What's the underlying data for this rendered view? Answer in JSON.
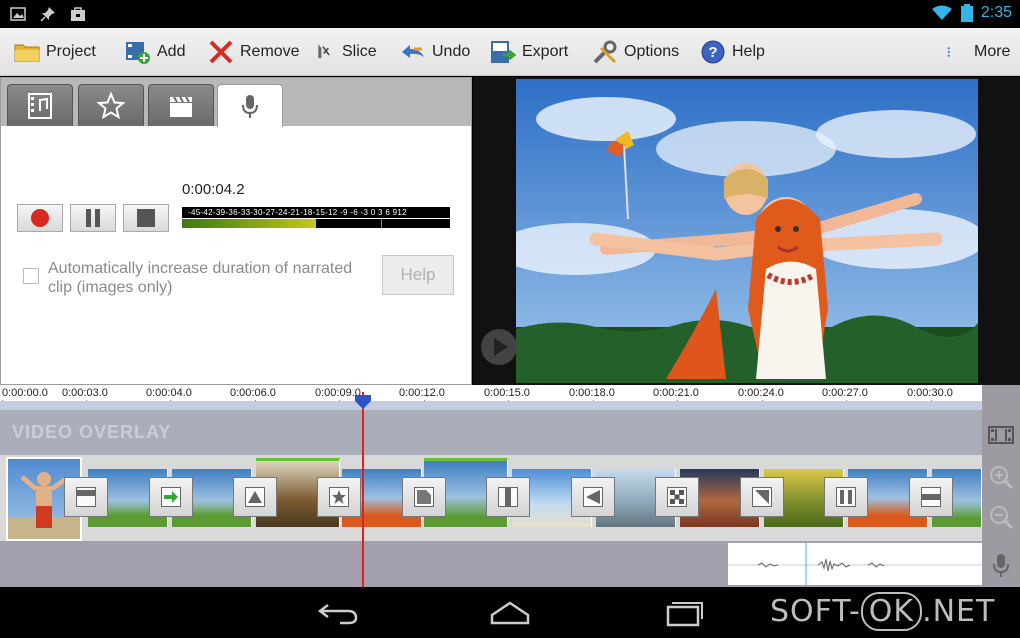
{
  "status_bar": {
    "time": "2:35"
  },
  "toolbar": {
    "project": "Project",
    "add": "Add",
    "remove": "Remove",
    "slice": "Slice",
    "undo": "Undo",
    "export": "Export",
    "options": "Options",
    "help": "Help",
    "more": "More"
  },
  "narration": {
    "elapsed": "0:00:04.2",
    "meter_scale": "-45-42-39-36-33-30-27-24-21-18-15-12 -9  -6  -3   0   3   6  912",
    "meter_level_fraction": 0.5,
    "auto_duration_label": "Automatically increase duration of narrated clip (images only)",
    "help_button": "Help"
  },
  "timeline": {
    "ruler_labels": [
      "0:00:00.0",
      "0:00:03.0",
      "0:00:04.0",
      "0:00:06.0",
      "0:00:09.0",
      "0:00:12.0",
      "0:00:15.0",
      "0:00:18.0",
      "0:00:21.0",
      "0:00:24.0",
      "0:00:27.0",
      "0:00:30.0"
    ],
    "overlay_track_label": "VIDEO OVERLAY"
  },
  "watermark": {
    "prefix": "SOFT-",
    "ok": "OK",
    "suffix": ".NET"
  },
  "colors": {
    "accent_green": "#6abf39",
    "playhead": "#e0201c",
    "toolbar_bg": "#e8e8e8"
  }
}
